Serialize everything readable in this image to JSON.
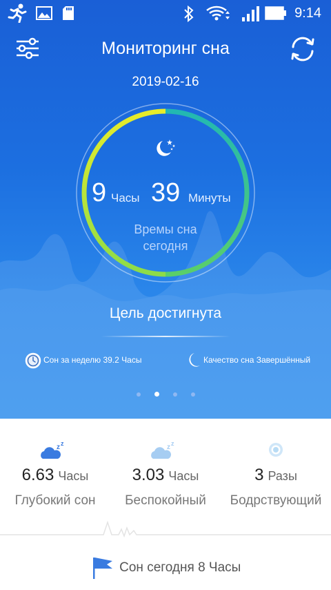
{
  "status_bar": {
    "time": "9:14"
  },
  "header": {
    "title": "Мониторинг сна"
  },
  "date": "2019-02-16",
  "ring": {
    "hours": "9",
    "hours_unit": "Часы",
    "minutes": "39",
    "minutes_unit": "Минуты",
    "caption_line1": "Времы сна",
    "caption_line2": "сегодня",
    "progress_fraction": 1.0
  },
  "goal_text": "Цель достигнута",
  "info": {
    "week": "Сон за неделю 39.2 Часы",
    "quality": "Качество сна Завершённый"
  },
  "pager": {
    "count": 4,
    "active_index": 1
  },
  "stats": [
    {
      "value": "6.63",
      "unit": "Часы",
      "label": "Глубокий сон",
      "icon": "deep-sleep-cloud-icon",
      "color": "#3a7be0"
    },
    {
      "value": "3.03",
      "unit": "Часы",
      "label": "Беспокойный",
      "icon": "light-sleep-cloud-icon",
      "color": "#9cc6f0"
    },
    {
      "value": "3",
      "unit": "Разы",
      "label": "Бодрствующий",
      "icon": "awake-icon",
      "color": "#b9dcf5"
    }
  ],
  "bottom_goal": {
    "text": "Сон сегодня 8 Часы",
    "icon": "flag-icon"
  },
  "colors": {
    "bg_top": "#1a5fd6",
    "ring_yellow": "#e4ea2e",
    "ring_teal": "#22b8a8",
    "accent": "#3a7be0"
  }
}
